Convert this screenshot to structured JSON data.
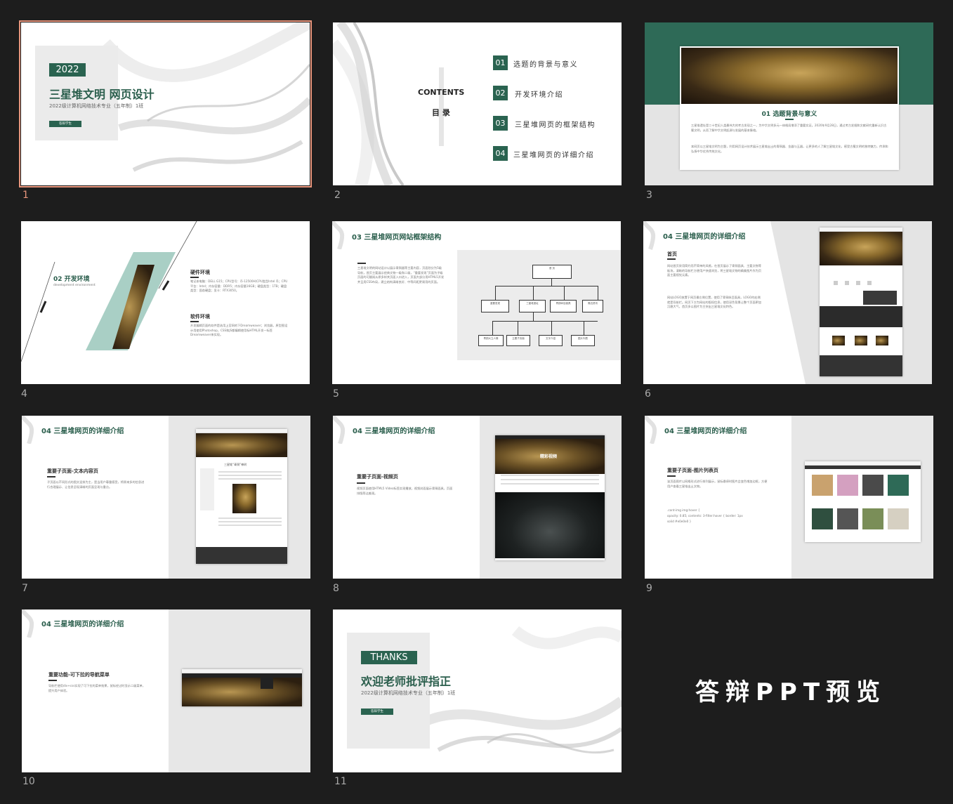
{
  "slides": [
    {
      "number": "1"
    },
    {
      "number": "2"
    },
    {
      "number": "3"
    },
    {
      "number": "4"
    },
    {
      "number": "5"
    },
    {
      "number": "6"
    },
    {
      "number": "7"
    },
    {
      "number": "8"
    },
    {
      "number": "9"
    },
    {
      "number": "10"
    },
    {
      "number": "11"
    }
  ],
  "s1": {
    "year": "2022",
    "title": "三星堆文明 网页设计",
    "subtitle": "2022级计算机网络技术专业（五年制）1班",
    "button": "答辩学生"
  },
  "s2": {
    "contents": "CONTENTS",
    "mulu": "目 录",
    "items": [
      {
        "num": "01",
        "label": "选题的背景与意义"
      },
      {
        "num": "02",
        "label": "开发环境介绍"
      },
      {
        "num": "03",
        "label": "三星堆网页的框架结构"
      },
      {
        "num": "04",
        "label": "三星堆网页的详细介绍"
      }
    ]
  },
  "s3": {
    "heading": "01 选题背景与意义",
    "para1": "三星堆遗址是二十世纪人类最伟大的考古发现之一，为中华文明多元一体格局增添了重要实证。2020年9月28日，通过考古发掘和文献研究重新认识古蜀文明，从而了解中华文明起源与发展的基本脉络。",
    "para2": "本网页以三星堆文明为主题，利用网页设计技术展示三星堆出土的青铜器、金器与玉器，让更多的人了解三星堆文化，感受古蜀文明的独特魅力，传承和弘扬中华优秀传统文化。"
  },
  "s4": {
    "heading": "02 开发环境",
    "subheading": "development environment",
    "hw_title": "硬件环境",
    "hw_text": "笔记本电脑：DELL G15；CPU型号：i5-12500H(CPU类型Intel i5；CPU平台：Intel；内存容量：DDR5；内存容量16GB；硬盘类型：1TB；硬盘类型：固态硬盘；显卡：RTX3050。",
    "sw_title": "软件环境",
    "sw_text": "开发编辑页面的软件是选用上官网的下Dreamweaver；浏览器，原型图设计用使用Photoshop，CSS和JS都编辑使用标HTML开发一标签Dreamweaver来实现。"
  },
  "s5": {
    "heading": "03 三星堆网页网站框架结构",
    "text": "三星堆文明的网站设计以展示青铜器等主要内容，页面划分为5级导航，首页主要展示经典文物一级和二级，“重要发现”页面为子级页面的可翻阅从原多样关页面入口进入，页面大部分用HTML5开发并且用CSS布局，建立结构清晰良好、中等间距更易用的页面。",
    "boxes": [
      "首 页",
      "重要发现",
      "三星堆遗址",
      "青铜纵目面具",
      "周边资讯",
      "青铜大立人像",
      "主要子页面",
      "文字介绍",
      "图片列表"
    ]
  },
  "s6": {
    "heading": "04 三星堆网页的详细介绍",
    "sub": "首页",
    "text1": "网站首页采用简约而不简单的风格，在首页展示了青铜面具、主要文物等板块，清晰的导航栏方便用户快速浏览，将三星堆文物的精美图片作为页面主要视觉元素。",
    "text2": "网站LOGO放置于网页最左侧位置，使用了青铜纵目面具，LOGO的右侧就是导航栏。网页下方为网站的版权信息，使用深色背景让整个页面更加沉稳大气，首页多以图片为主突出三星堆文化特色。"
  },
  "s7": {
    "heading": "04 三星堆网页的详细介绍",
    "sub": "重要子页面-文本内容页",
    "text": "子页面以不同形式的图文混排为主，是当用户尊重感受，将原来多的信息进行合理展示、让信息呈现清晰的页面呈现与重点。",
    "mock_title": "三星堆“青铜”神树"
  },
  "s8": {
    "heading": "04 三星堆网页的详细介绍",
    "sub": "重要子页面-视频页",
    "text": "视频页面使用HTML5 Video标签实现播放，视频封面展示青铜面具，页面排版简洁美观。",
    "banner_text": "精彩视频"
  },
  "s9": {
    "heading": "04 三星堆网页的详细介绍",
    "sub": "重要子页面-图片列表页",
    "text": "该页面图片以网格形式进行排列展示，鼠标悬停时图片会变色增加边框，方便用户查看三星堆出土文物。",
    "code1": ".cont-img img:hover {",
    "code2": "opacity: 0.85; contents: 3-filter:hover { border: 1px",
    "code3": "solid #e0e0e0 }"
  },
  "s10": {
    "heading": "04 三星堆网页的详细介绍",
    "sub": "重要功能-可下拉的导航菜单",
    "text": "导航栏使用div+css实现了可下拉的菜单效果，鼠标经过时显示二级菜单，提升用户体验。"
  },
  "s11": {
    "thanks": "THANKS",
    "title": "欢迎老师批评指正",
    "subtitle": "2022级计算机网络技术专业（五年制）1班",
    "button": "答辩学生"
  },
  "preview_label": "答辩PPT预览",
  "colors": {
    "accent": "#2a6350",
    "selection": "#e8957c",
    "background": "#1d1d1d"
  }
}
